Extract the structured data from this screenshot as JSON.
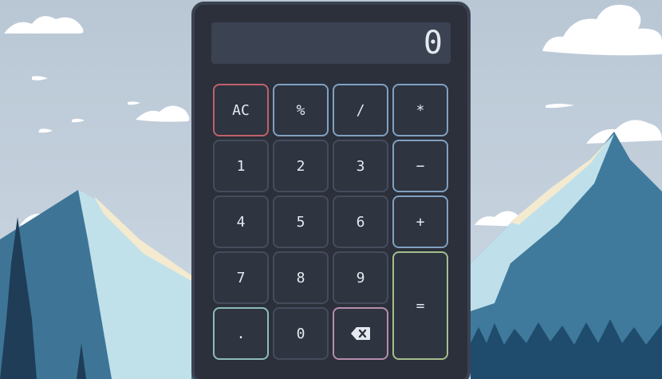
{
  "calculator": {
    "display_value": "0",
    "keys": {
      "clear": "AC",
      "percent": "%",
      "divide": "/",
      "multiply": "*",
      "one": "1",
      "two": "2",
      "three": "3",
      "minus": "−",
      "four": "4",
      "five": "5",
      "six": "6",
      "plus": "+",
      "seven": "7",
      "eight": "8",
      "nine": "9",
      "equals": "=",
      "decimal": ".",
      "zero": "0",
      "backspace_icon": "backspace-icon"
    }
  },
  "colors": {
    "sky": "#c3cfdc",
    "body": "#2b303b",
    "display": "#3b4252",
    "operator_border": "#81a1c1",
    "clear_border": "#bf616a",
    "equals_border": "#a3be8c",
    "decimal_border": "#8fbcbb",
    "backspace_border": "#b48ead"
  }
}
